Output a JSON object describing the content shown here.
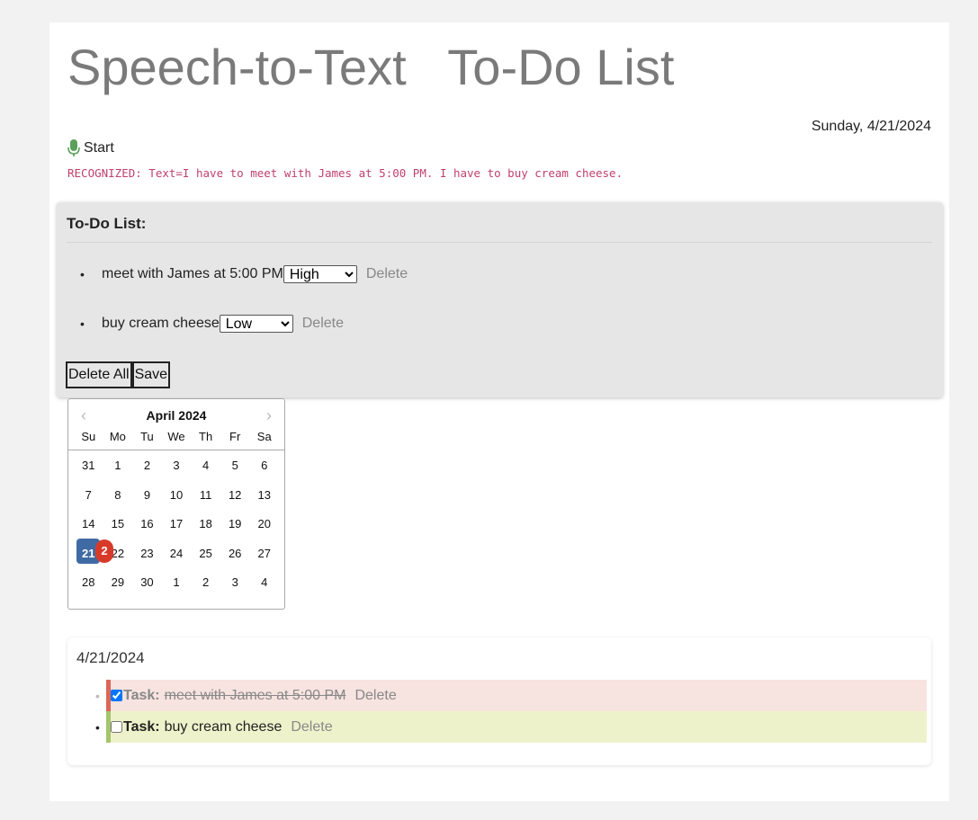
{
  "header": {
    "title": "Speech-to-Text   To-Do List",
    "date": "Sunday, 4/21/2024"
  },
  "speech": {
    "start_label": "Start",
    "recognized": "RECOGNIZED: Text=I have to meet with James at 5:00 PM. I have to buy cream cheese."
  },
  "todo": {
    "heading": "To-Do List:",
    "items": [
      {
        "text": "meet with James at 5:00 PM",
        "priority": "High",
        "delete": "Delete"
      },
      {
        "text": "buy cream cheese",
        "priority": "Low",
        "delete": "Delete"
      }
    ],
    "delete_all": "Delete All",
    "save": "Save"
  },
  "calendar": {
    "month": "April 2024",
    "dow": [
      "Su",
      "Mo",
      "Tu",
      "We",
      "Th",
      "Fr",
      "Sa"
    ],
    "weeks": [
      [
        "31",
        "1",
        "2",
        "3",
        "4",
        "5",
        "6"
      ],
      [
        "7",
        "8",
        "9",
        "10",
        "11",
        "12",
        "13"
      ],
      [
        "14",
        "15",
        "16",
        "17",
        "18",
        "19",
        "20"
      ],
      [
        "21",
        "22",
        "23",
        "24",
        "25",
        "26",
        "27"
      ],
      [
        "28",
        "29",
        "30",
        "1",
        "2",
        "3",
        "4"
      ]
    ],
    "selected": "21",
    "badge": "2",
    "accent": "#3f6aa4",
    "badge_color": "#d83a2a"
  },
  "tasks": {
    "date": "4/21/2024",
    "items": [
      {
        "label": "Task:",
        "text": "meet with James at 5:00 PM",
        "done": true,
        "delete": "Delete"
      },
      {
        "label": "Task:",
        "text": "buy cream cheese",
        "done": false,
        "delete": "Delete"
      }
    ]
  }
}
